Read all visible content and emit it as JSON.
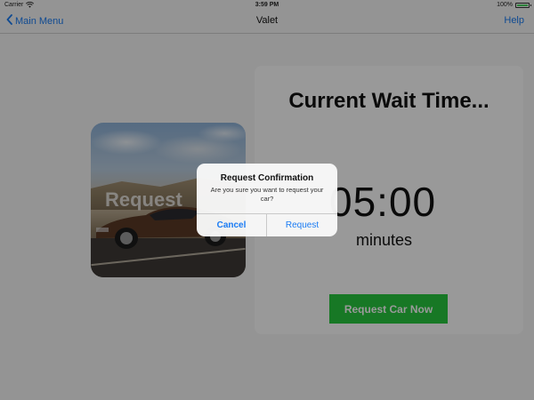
{
  "status_bar": {
    "carrier": "Carrier",
    "time": "3:59 PM",
    "battery_percent": "100%",
    "battery_level": 1.0,
    "icons": [
      "wifi-icon",
      "battery-icon"
    ]
  },
  "nav": {
    "back_label": "Main Menu",
    "back_icon": "chevron-left-icon",
    "title": "Valet",
    "help_label": "Help"
  },
  "request_card": {
    "label": "Request"
  },
  "wait_card": {
    "title": "Current Wait Time...",
    "time": "05:00",
    "unit": "minutes",
    "button_label": "Request Car Now"
  },
  "alert": {
    "title": "Request Confirmation",
    "message": "Are you sure you want to request your car?",
    "cancel_label": "Cancel",
    "confirm_label": "Request"
  },
  "colors": {
    "accent": "#1a7cf4",
    "button_green": "#27c93f",
    "battery_green": "#4cd964"
  }
}
